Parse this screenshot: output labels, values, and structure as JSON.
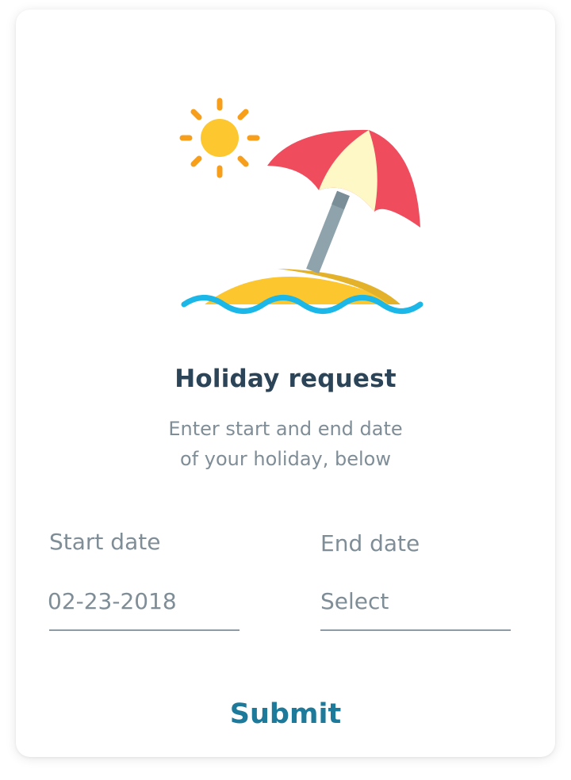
{
  "illustration": {
    "icons": [
      "sun-icon",
      "beach-umbrella-icon",
      "island-icon",
      "waves-icon"
    ],
    "colors": {
      "sun": "#fdc72f",
      "sun_rays": "#f79e1b",
      "umbrella_red": "#ef4c5e",
      "umbrella_cream": "#fef8c6",
      "pole": "#8fa3ad",
      "sand": "#fcc62f",
      "sand_shadow": "#e3b12a",
      "water": "#1ab7e8"
    }
  },
  "form": {
    "title": "Holiday request",
    "subtitle_line1": "Enter start and end date",
    "subtitle_line2": "of your holiday, below",
    "start_date": {
      "label": "Start date",
      "value": "02-23-2018"
    },
    "end_date": {
      "label": "End date",
      "value": "Select"
    },
    "submit_label": "Submit"
  },
  "colors": {
    "title": "#2c4458",
    "muted_text": "#7f8d97",
    "accent": "#1e7a9a"
  }
}
